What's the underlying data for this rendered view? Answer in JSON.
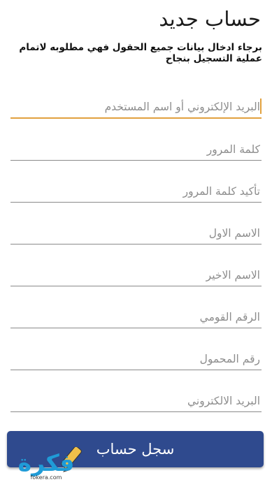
{
  "header": {
    "title": "حساب جديد",
    "subtitle": "برجاء ادخال بيانات جميع الحقول فهي مطلوبه لاتمام عملية التسجيل بنجاح"
  },
  "form": {
    "fields": [
      {
        "placeholder": "البريد الإلكتروني أو اسم المستخدم"
      },
      {
        "placeholder": "كلمة المرور"
      },
      {
        "placeholder": "تأكيد كلمة المرور"
      },
      {
        "placeholder": "الاسم الاول"
      },
      {
        "placeholder": "الاسم الاخير"
      },
      {
        "placeholder": "الرقم القومي"
      },
      {
        "placeholder": "رقم المحمول"
      },
      {
        "placeholder": "البريد الالكتروني"
      }
    ],
    "submit_label": "سجل حساب"
  },
  "watermark": {
    "logo": "فكرة",
    "site": "fokera.com"
  },
  "colors": {
    "accent": "#e1a13f",
    "button": "#2f4a8e",
    "watermark": "#1f9bd7"
  }
}
